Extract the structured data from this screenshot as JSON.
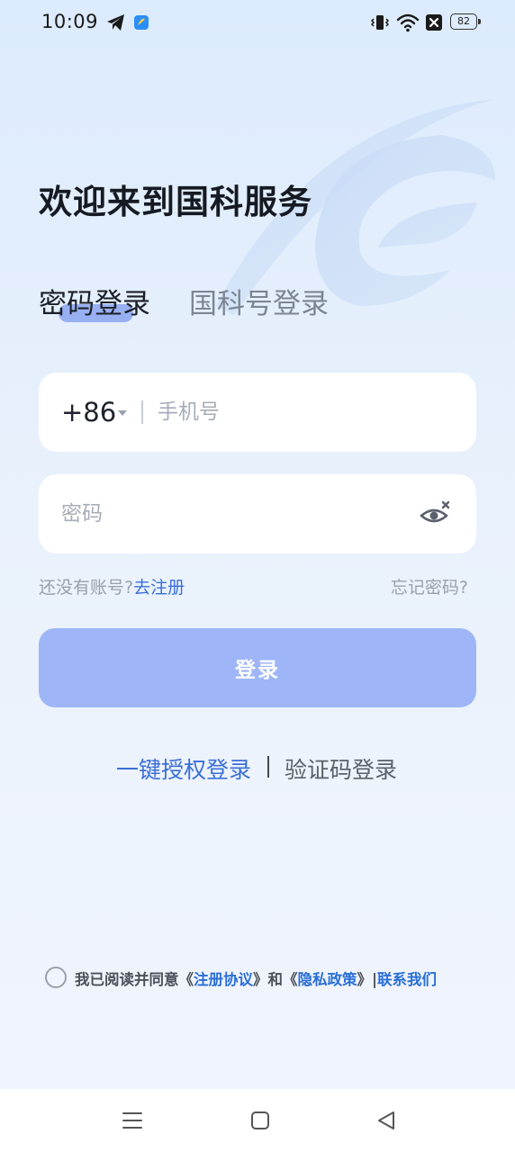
{
  "status_bar": {
    "time": "10:09",
    "battery": "82",
    "icons": [
      "telegram-icon",
      "app-notify-icon",
      "vibrate-icon",
      "wifi-icon",
      "no-sim-icon",
      "battery-icon"
    ]
  },
  "welcome_title": "欢迎来到国科服务",
  "tabs": [
    {
      "label": "密码登录",
      "active": true
    },
    {
      "label": "国科号登录",
      "active": false
    }
  ],
  "phone_field": {
    "country_code": "+86",
    "placeholder": "手机号",
    "value": ""
  },
  "password_field": {
    "placeholder": "密码",
    "value": "",
    "toggle_icon": "eye-hidden-icon"
  },
  "register": {
    "prompt": "还没有账号?",
    "link": "去注册"
  },
  "forgot_password": "忘记密码?",
  "login_button": "登录",
  "alt_login": {
    "one_key": "一键授权登录",
    "sms": "验证码登录"
  },
  "agreement": {
    "prefix": "我已阅读并同意《",
    "terms": "注册协议",
    "middle": "》和《",
    "privacy": "隐私政策",
    "suffix": "》|",
    "contact": "联系我们"
  },
  "colors": {
    "accent": "#3a6fd8",
    "login_button": "#9eb6f7",
    "tab_underline": "#8ba4f0"
  }
}
